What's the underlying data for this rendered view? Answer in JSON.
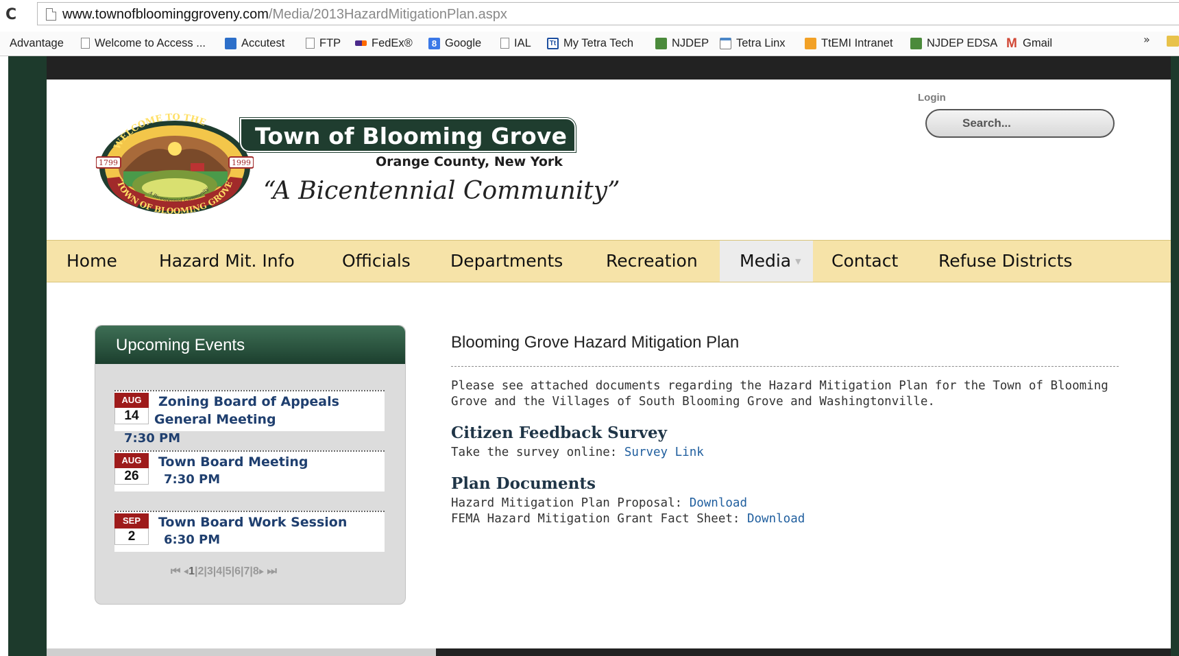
{
  "browser": {
    "url_host": "www.townofbloominggroveny.com",
    "url_path": "/Media/2013HazardMitigationPlan.aspx",
    "bookmarks": [
      "Advantage",
      "Welcome to Access ...",
      "Accutest",
      "FTP",
      "FedEx®",
      "Google",
      "IAL",
      "My Tetra Tech",
      "NJDEP",
      "Tetra Linx",
      "TtEMI Intranet",
      "NJDEP EDSA",
      "Gmail"
    ],
    "overflow": "»"
  },
  "header": {
    "title": "Town of Blooming Grove",
    "subtitle": "Orange County, New York",
    "tagline": "“A Bicentennial Community”",
    "logo": {
      "top_text": "WELCOME TO THE",
      "bottom_text": "TOWN OF BLOOMING GROVE",
      "year_left": "1799",
      "year_right": "1999",
      "small_text": "A Bicentennial Community"
    },
    "login_label": "Login",
    "search_placeholder": "Search..."
  },
  "nav": {
    "items": [
      "Home",
      "Hazard Mit. Info",
      "Officials",
      "Departments",
      "Recreation",
      "Media",
      "Contact",
      "Refuse Districts"
    ],
    "active": "Media",
    "bg_color": "#f6e3a8"
  },
  "events": {
    "title": "Upcoming Events",
    "items": [
      {
        "month": "AUG",
        "day": "14",
        "title": "Zoning Board of Appeals",
        "title2": "General Meeting",
        "time": "7:30 PM"
      },
      {
        "month": "AUG",
        "day": "26",
        "title": "Town Board Meeting",
        "time": "7:30 PM"
      },
      {
        "month": "SEP",
        "day": "2",
        "title": "Town Board Work Session",
        "time": "6:30 PM"
      }
    ],
    "pager": {
      "first": "⏮",
      "prev": "◂",
      "pages": [
        "1",
        "2",
        "3",
        "4",
        "5",
        "6",
        "7",
        "8"
      ],
      "next": "▸",
      "last": "⏭"
    }
  },
  "content": {
    "title": "Blooming Grove Hazard Mitigation Plan",
    "intro": "Please see attached documents regarding the Hazard Mitigation Plan for the Town of Blooming Grove and the Villages of South Blooming Grove and Washingtonville.",
    "survey_heading": "Citizen Feedback Survey",
    "survey_text": "Take the survey online: ",
    "survey_link": "Survey Link",
    "docs_heading": "Plan Documents",
    "doc1_text": "Hazard Mitigation Plan Proposal: ",
    "doc1_link": "Download",
    "doc2_text": "FEMA Hazard Mitigation Grant Fact Sheet: ",
    "doc2_link": "Download"
  },
  "colors": {
    "frame": "#1d3a2c",
    "banner": "#1f3d2f",
    "date_badge": "#9e1b1b",
    "link": "#1f5e9e"
  }
}
